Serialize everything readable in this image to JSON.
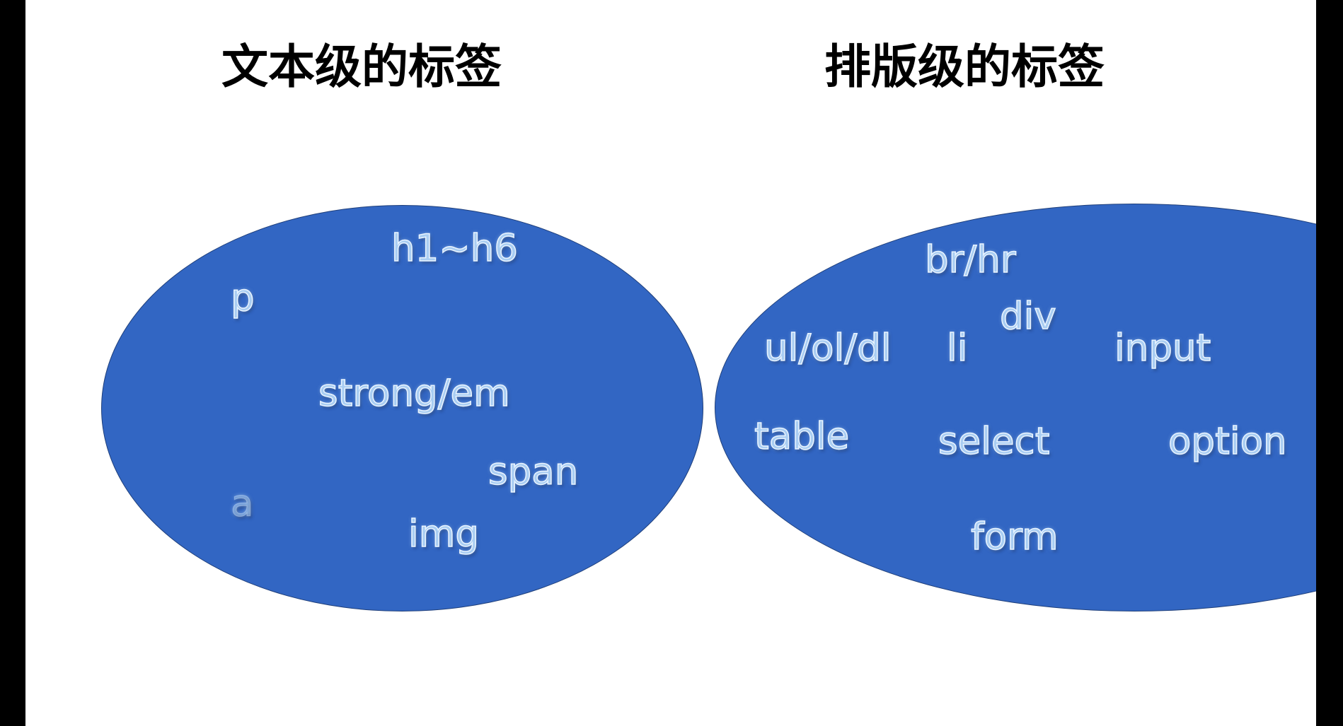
{
  "left_group": {
    "title": "文本级的标签",
    "tags": [
      "h1~h6",
      "p",
      "strong/em",
      "span",
      "a",
      "img"
    ]
  },
  "right_group": {
    "title": "排版级的标签",
    "tags": [
      "br/hr",
      "div",
      "ul/ol/dl",
      "li",
      "input",
      "table",
      "select",
      "option",
      "form"
    ]
  },
  "colors": {
    "ellipse_fill": "#3266c3",
    "tag_text": "#a9cdf2",
    "heading_text": "#000000"
  }
}
